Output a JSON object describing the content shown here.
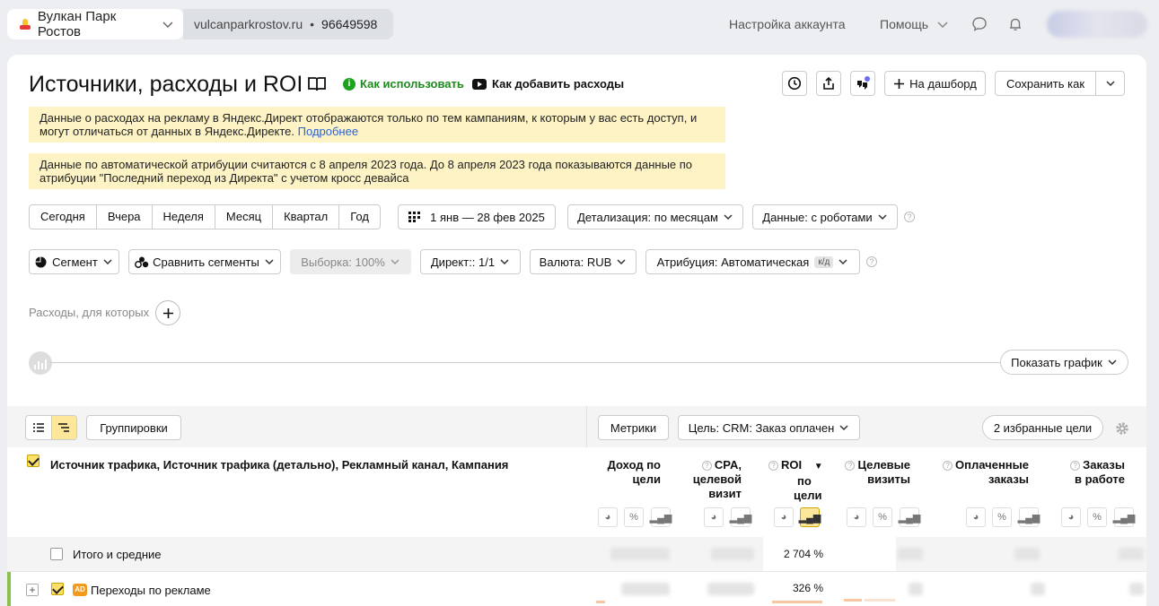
{
  "topbar": {
    "site_name": "Вулкан Парк Ростов",
    "domain": "vulcanparkrostov.ru",
    "separator": "•",
    "counter_id": "96649598",
    "account_settings": "Настройка аккаунта",
    "help": "Помощь"
  },
  "page": {
    "title": "Источники, расходы и ROI",
    "how_to_use": "Как использовать",
    "how_to_add_costs": "Как добавить расходы",
    "to_dashboard": "На дашборд",
    "save_as": "Сохранить как"
  },
  "notices": {
    "direct_notice_text": "Данные о расходах на рекламу в Яндекс.Директ отображаются только по тем кампаниям, к которым у вас есть доступ, и могут отличаться от данных в Яндекс.Директе.",
    "direct_notice_link": "Подробнее",
    "attribution_notice": "Данные по автоматической атрибуции считаются с 8 апреля 2023 года. До 8 апреля 2023 года показываются данные по атрибуции \"Последний переход из Директа\" с учетом кросс девайса"
  },
  "period": {
    "buttons": [
      "Сегодня",
      "Вчера",
      "Неделя",
      "Месяц",
      "Квартал",
      "Год"
    ],
    "date_range": "1 янв — 28 фев 2025",
    "detail": "Детализация: по месяцам",
    "data_robots": "Данные: с роботами"
  },
  "filters": {
    "segment": "Сегмент",
    "compare_segments": "Сравнить сегменты",
    "sample": "Выборка: 100%",
    "direct": "Директ:: 1/1",
    "currency": "Валюта: RUB",
    "attribution": "Атрибуция: Автоматическая",
    "attribution_badge": "к/д"
  },
  "expenses_label": "Расходы, для которых",
  "show_chart": "Показать график",
  "table": {
    "groupings": "Группировки",
    "metrics": "Метрики",
    "goal": "Цель: CRM: Заказ оплачен",
    "favorite_goals": "2 избранные цели",
    "dimension_title": "Источник трафика, Источник трафика (детально), Рекламный канал, Кампания",
    "columns": [
      {
        "l1": "Доход по",
        "l2": "цели",
        "l3": ""
      },
      {
        "l1": "CPA,",
        "l2": "целевой",
        "l3": "визит"
      },
      {
        "l1": "ROI",
        "l2": "по",
        "l3": "цели"
      },
      {
        "l1": "Целевые",
        "l2": "визиты",
        "l3": ""
      },
      {
        "l1": "Оплаченные",
        "l2": "заказы",
        "l3": ""
      },
      {
        "l1": "Заказы",
        "l2": "в работе",
        "l3": ""
      }
    ],
    "sort_marker": "▼",
    "totals_label": "Итого и средние",
    "totals_roi": "2 704 %",
    "row1_label": "Переходы по рекламе",
    "row1_badge": "AD",
    "row1_roi": "326 %"
  },
  "colors": {
    "notice_bg": "#fdf3c4",
    "accent_yellow": "#fce79a",
    "link_blue": "#2962d9",
    "green_link": "#1c8a1c",
    "row_marker_green": "#8bc34a",
    "ad_badge_orange": "#f29a1e"
  },
  "icons": [
    "chevron-down-icon",
    "chat-icon",
    "bell-icon",
    "book-icon",
    "history-icon",
    "share-icon",
    "assistant-icon",
    "plus-icon",
    "calendar-icon",
    "pie-icon",
    "compare-icon",
    "chart-icon",
    "gear-icon",
    "list-icon",
    "tree-icon",
    "percent-icon"
  ]
}
